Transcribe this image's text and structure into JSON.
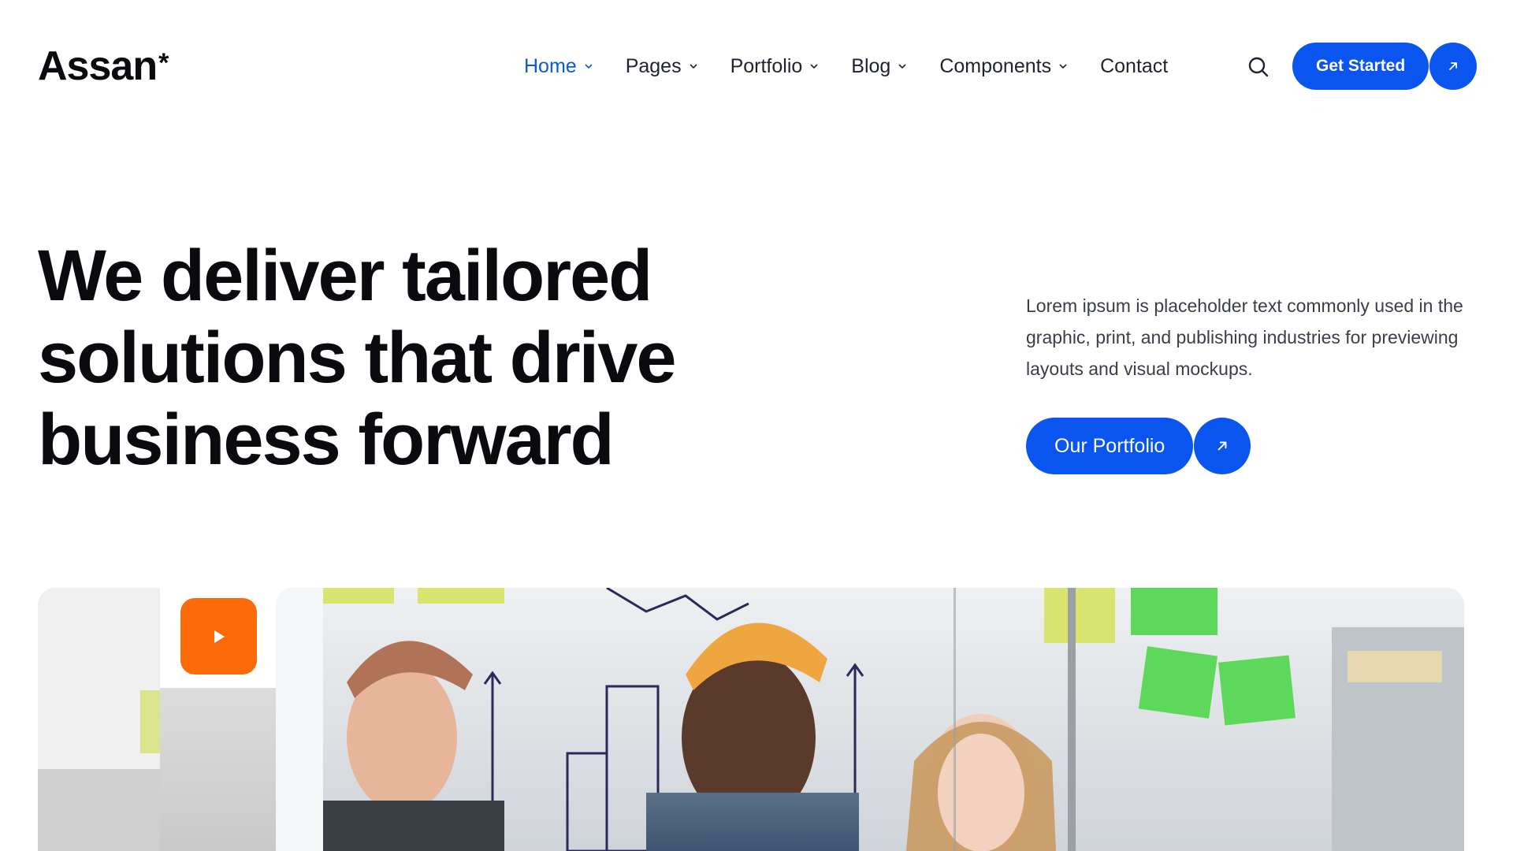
{
  "brand": {
    "name": "Assan",
    "mark": "*"
  },
  "nav": {
    "items": [
      {
        "label": "Home",
        "has_dropdown": true,
        "active": true
      },
      {
        "label": "Pages",
        "has_dropdown": true,
        "active": false
      },
      {
        "label": "Portfolio",
        "has_dropdown": true,
        "active": false
      },
      {
        "label": "Blog",
        "has_dropdown": true,
        "active": false
      },
      {
        "label": "Components",
        "has_dropdown": true,
        "active": false
      },
      {
        "label": "Contact",
        "has_dropdown": false,
        "active": false
      }
    ],
    "search_icon": "search-icon",
    "cta_label": "Get Started",
    "cta_icon": "arrow-up-right-icon"
  },
  "hero": {
    "title_lines": [
      "We deliver tailored",
      "solutions that drive",
      "business forward"
    ],
    "description": "Lorem ipsum is placeholder text commonly used in the graphic, print, and publishing industries for previewing layouts and visual mockups.",
    "cta_label": "Our Portfolio",
    "cta_icon": "arrow-up-right-icon"
  },
  "media": {
    "play_icon": "play-icon",
    "image": "team-brainstorm-photo"
  },
  "colors": {
    "accent": "#0a54f0",
    "nav_active": "#0a5cd5",
    "play": "#fb6b0a",
    "text": "#0b0b0f",
    "muted": "#3a3d4a"
  }
}
